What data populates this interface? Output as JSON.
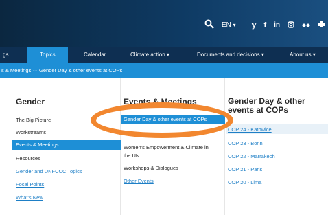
{
  "header": {
    "language": "EN",
    "language_caret": "▾",
    "icons": {
      "search": "search-icon",
      "twitter": "twitter-icon",
      "facebook": "facebook-icon",
      "linkedin": "linkedin-icon",
      "instagram": "instagram-icon",
      "flickr": "flickr-icon",
      "print": "print-icon"
    }
  },
  "nav": {
    "items": [
      "gs",
      "Topics",
      "Calendar",
      "Climate action ▾",
      "Documents and decisions ▾",
      "About us ▾"
    ],
    "active_index": 1
  },
  "breadcrumb": {
    "text": "s & Meetings  ···  Gender Day & other events at COPs"
  },
  "menu": {
    "col1": {
      "heading": "Gender",
      "items": [
        "The Big Picture",
        "Workstreams",
        "Events & Meetings",
        "Resources",
        "Gender and UNFCCC Topics",
        "Focal Points",
        "What's New"
      ]
    },
    "col2": {
      "heading": "Events & Meetings",
      "items": [
        "Gender Day & other events at COPs",
        "Women's Empowerment & Climate in",
        "the UN",
        "Workshops & Dialogues",
        "Other Events"
      ]
    },
    "col3": {
      "heading_line1": "Gender Day & other",
      "heading_line2": "events at COPs",
      "items": [
        "COP 24 - Katowice",
        "COP 23 - Bonn",
        "COP 22 - Marrakech",
        "COP 21 - Paris",
        "COP 20 - Lima"
      ]
    }
  },
  "colors": {
    "accent": "#1e8fd6",
    "nav_bg": "#0e2f52",
    "highlight_oval": "#f2872f",
    "link": "#1e7fc6"
  }
}
